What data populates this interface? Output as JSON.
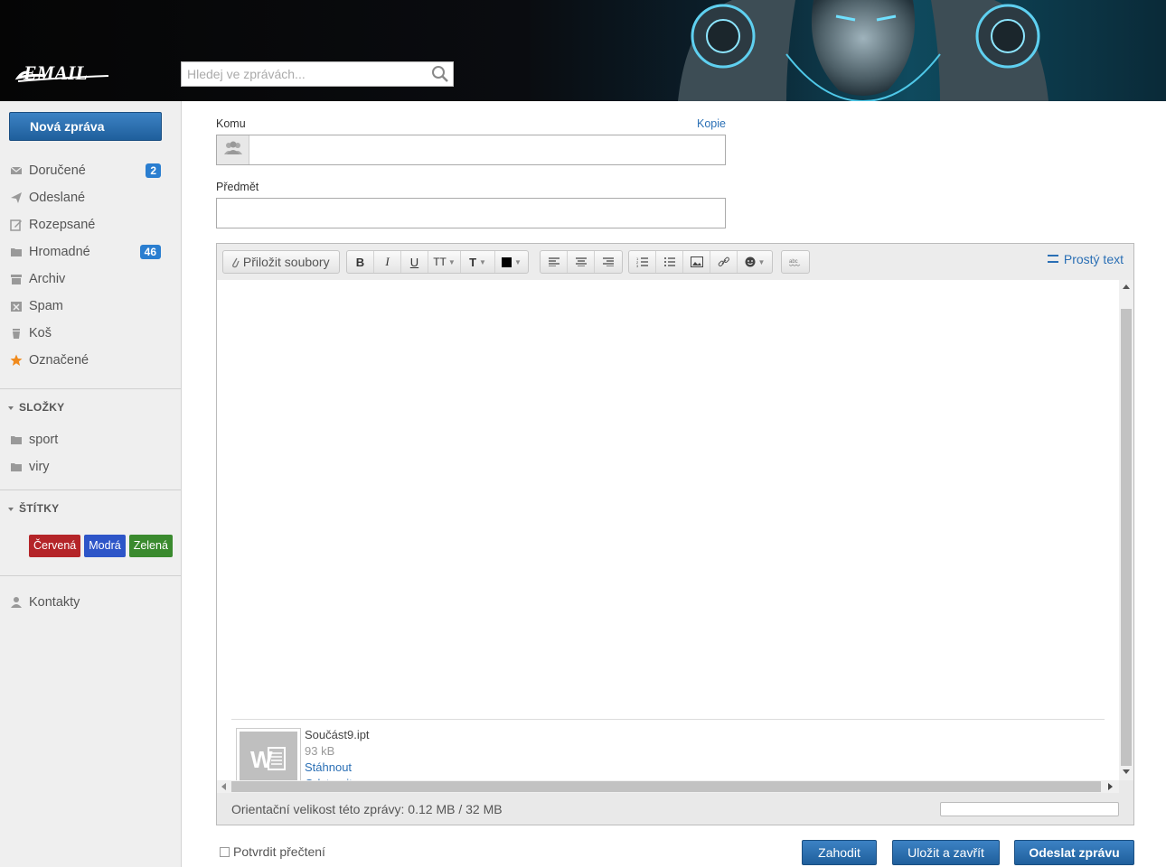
{
  "header": {
    "logo_text": "EMAIL",
    "search_placeholder": "Hledej ve zprávách..."
  },
  "sidebar": {
    "new_message": "Nová zpráva",
    "items": [
      {
        "label": "Doručené",
        "icon": "envelope-icon",
        "badge": "2"
      },
      {
        "label": "Odeslané",
        "icon": "send-icon"
      },
      {
        "label": "Rozepsané",
        "icon": "edit-icon"
      },
      {
        "label": "Hromadné",
        "icon": "folder-icon",
        "badge": "46"
      },
      {
        "label": "Archiv",
        "icon": "archive-icon"
      },
      {
        "label": "Spam",
        "icon": "spam-icon"
      },
      {
        "label": "Koš",
        "icon": "trash-icon"
      },
      {
        "label": "Označené",
        "icon": "star-icon"
      }
    ],
    "folders_heading": "SLOŽKY",
    "folders": [
      {
        "label": "sport",
        "icon": "folder-icon"
      },
      {
        "label": "viry",
        "icon": "folder-icon"
      }
    ],
    "tags_heading": "ŠTÍTKY",
    "tags": [
      {
        "label": "Červená",
        "color": "#b42428"
      },
      {
        "label": "Modrá",
        "color": "#2d55c8"
      },
      {
        "label": "Zelená",
        "color": "#3a8a2e"
      }
    ],
    "contacts": "Kontakty"
  },
  "compose": {
    "to_label": "Komu",
    "cc_link": "Kopie",
    "to_value": "",
    "subject_label": "Předmět",
    "subject_value": "",
    "attach_button": "Přiložit soubory",
    "plain_text_link": "Prostý text",
    "toolbar": {
      "bold": "B",
      "italic": "I",
      "underline": "U",
      "font_size": "TT",
      "font_family": "T",
      "text_color": "#000000"
    },
    "attachment": {
      "name": "Součást9.ipt",
      "size": "93 kB",
      "download": "Stáhnout",
      "remove": "Odstranit"
    },
    "size_text": "Orientační velikost této zprávy: 0.12 MB / 32 MB",
    "confirm_read": "Potvrdit přečtení",
    "discard": "Zahodit",
    "save_close": "Uložit a zavřít",
    "send": "Odeslat zprávu"
  },
  "colors": {
    "accent": "#2a6fb5",
    "button": "#1f5f9c",
    "badge": "#2a7ed0"
  }
}
